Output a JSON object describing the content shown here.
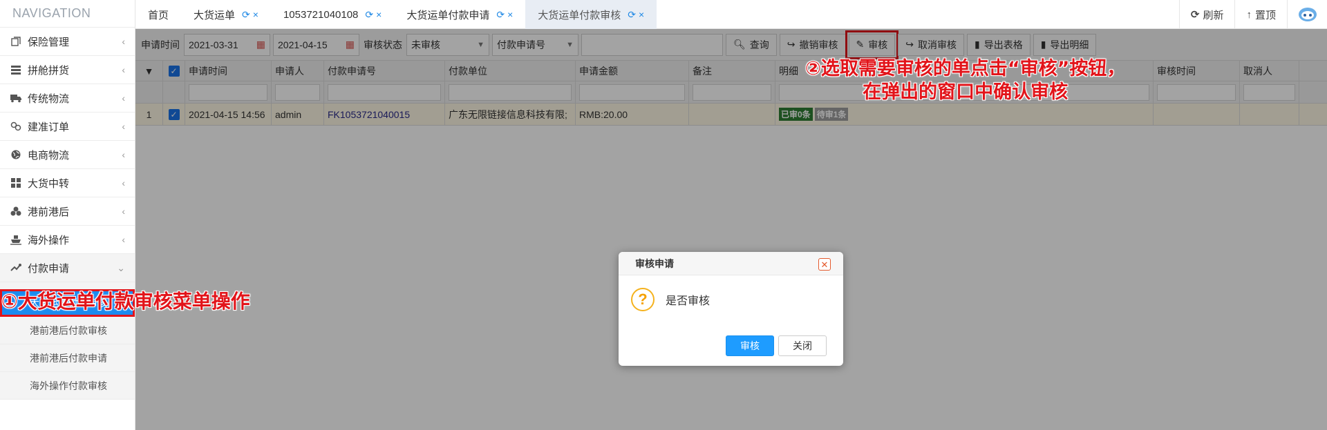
{
  "sidebar": {
    "title": "NAVIGATION",
    "items": [
      {
        "label": "保险管理",
        "icon": "document-copy-icon"
      },
      {
        "label": "拼舱拼货",
        "icon": "list-icon"
      },
      {
        "label": "传统物流",
        "icon": "truck-icon"
      },
      {
        "label": "建准订单",
        "icon": "link-icon"
      },
      {
        "label": "电商物流",
        "icon": "globe-icon"
      },
      {
        "label": "大货中转",
        "icon": "grid-icon"
      },
      {
        "label": "港前港后",
        "icon": "cubes-icon"
      },
      {
        "label": "海外操作",
        "icon": "ship-icon"
      },
      {
        "label": "付款申请",
        "icon": "payment-icon"
      }
    ],
    "subitems": [
      {
        "label": "大货运单付款审核",
        "active": true
      },
      {
        "label": "港前港后付款审核"
      },
      {
        "label": "港前港后付款申请"
      },
      {
        "label": "海外操作付款审核"
      }
    ]
  },
  "tabs": [
    {
      "label": "首页"
    },
    {
      "label": "大货运单"
    },
    {
      "label": "1053721040108"
    },
    {
      "label": "大货运单付款申请"
    },
    {
      "label": "大货运单付款审核",
      "active": true
    }
  ],
  "topbar": {
    "refresh": "刷新",
    "top": "置顶"
  },
  "toolbar": {
    "date_label": "申请时间",
    "date_from": "2021-03-31",
    "date_to": "2021-04-15",
    "status_label": "审核状态",
    "status_value": "未审核",
    "field_select": "付款申请号",
    "search_text": "",
    "query": "查询",
    "revoke": "撤销审核",
    "audit": "审核",
    "cancel_audit": "取消审核",
    "export_table": "导出表格",
    "export_detail": "导出明细"
  },
  "grid": {
    "columns": [
      "申请时间",
      "申请人",
      "付款申请号",
      "付款单位",
      "申请金额",
      "备注",
      "明细",
      "审核时间",
      "取消人"
    ],
    "rows": [
      {
        "index": "1",
        "apply_time": "2021-04-15 14:56",
        "applicant": "admin",
        "apply_no": "FK1053721040015",
        "payer": "广东无限链接信息科技有限;",
        "amount": "RMB:20.00",
        "remark": "",
        "badge_done": "已审0条",
        "badge_pending": "待审1条"
      }
    ]
  },
  "dialog": {
    "title": "审核申请",
    "message": "是否审核",
    "confirm": "审核",
    "close": "关闭"
  },
  "annotations": {
    "step1": "①大货运单付款审核菜单操作",
    "step2_line1": "②选取需要审核的单点击“审核”按钮，",
    "step2_line2": "在弹出的窗口中确认审核"
  },
  "colors": {
    "accent": "#1e9cff",
    "annotation": "#e2141a",
    "active_menu": "#1c8bef",
    "row_highlight": "#fdf8e4"
  }
}
